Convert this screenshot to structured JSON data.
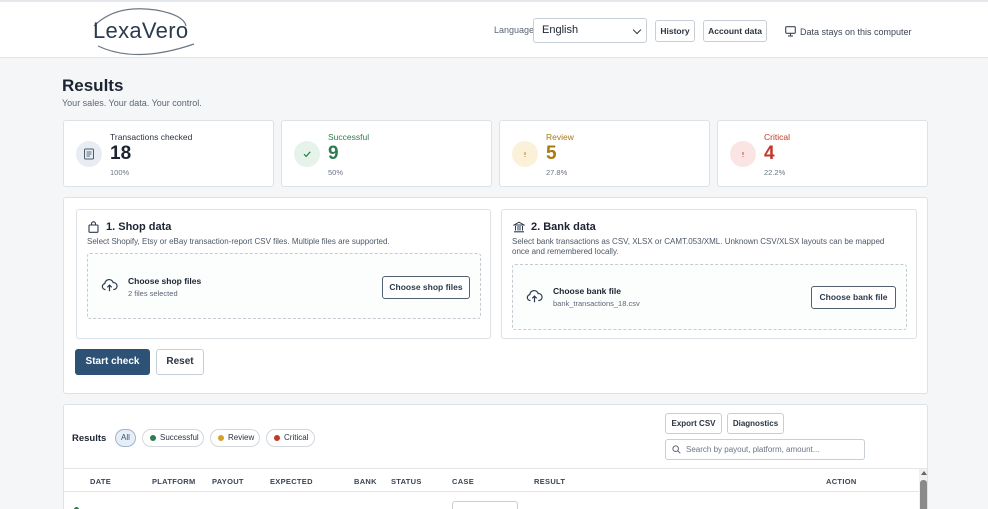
{
  "header": {
    "brand": "LexaVero",
    "language_label": "Language",
    "language_value": "English",
    "history_label": "History",
    "account_label": "Account data",
    "privacy_note": "Data stays on this computer"
  },
  "page": {
    "title": "Results",
    "subtitle": "Your sales. Your data. Your control."
  },
  "stats": [
    {
      "label": "Transactions checked",
      "value": "18",
      "pct": "100%",
      "color": "#1b2430",
      "icon": "document-icon"
    },
    {
      "label": "Successful",
      "value": "9",
      "pct": "50%",
      "color": "#2e7d4f",
      "icon": "check-icon"
    },
    {
      "label": "Review",
      "value": "5",
      "pct": "27.8%",
      "color": "#a77b12",
      "icon": "info-icon"
    },
    {
      "label": "Critical",
      "value": "4",
      "pct": "22.2%",
      "color": "#c0392b",
      "icon": "alert-icon"
    }
  ],
  "shop": {
    "title": "1. Shop data",
    "desc": "Select Shopify, Etsy or eBay transaction-report CSV files. Multiple files are supported.",
    "drop_title": "Choose shop files",
    "drop_status": "2 files selected",
    "button": "Choose shop files"
  },
  "bank": {
    "title": "2. Bank data",
    "desc": "Select bank transactions as CSV, XLSX or CAMT.053/XML. Unknown CSV/XLSX layouts can be mapped once and remembered locally.",
    "drop_title": "Choose bank file",
    "drop_status": "bank_transactions_18.csv",
    "button": "Choose bank file"
  },
  "actions": {
    "start": "Start check",
    "reset": "Reset"
  },
  "results": {
    "label": "Results",
    "filters": {
      "all": "All",
      "successful": "Successful",
      "review": "Review",
      "critical": "Critical"
    },
    "export": "Export CSV",
    "diagnostics": "Diagnostics",
    "search_placeholder": "Search by payout, platform, amount...",
    "columns": [
      "DATE",
      "PLATFORM",
      "PAYOUT",
      "EXPECTED",
      "BANK",
      "STATUS",
      "CASE",
      "RESULT",
      "ACTION"
    ]
  },
  "colors": {
    "accent": "#2e5276",
    "success": "#2e7d4f",
    "review": "#d4a12a",
    "critical": "#c0392b"
  }
}
